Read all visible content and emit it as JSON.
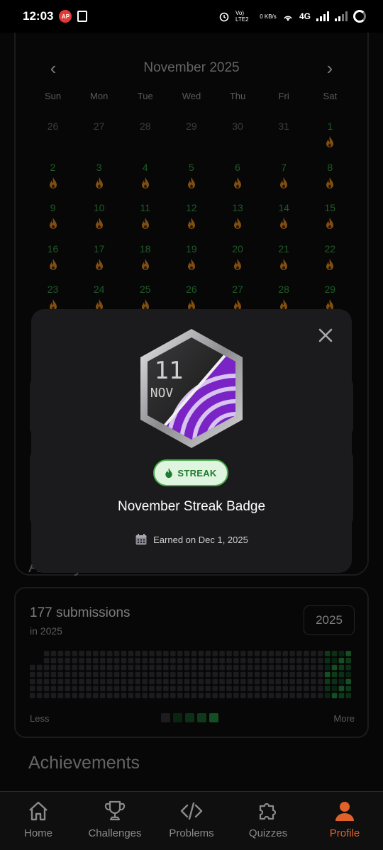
{
  "status_bar": {
    "time": "12:03",
    "ap": "AP",
    "net_speed": "0 KB/s",
    "network": "4G",
    "volte": "Vo) LTE2"
  },
  "calendar": {
    "month": "November 2025",
    "prev_icon": "chevron-left-icon",
    "next_icon": "chevron-right-icon",
    "weekdays": [
      "Sun",
      "Mon",
      "Tue",
      "Wed",
      "Thu",
      "Fri",
      "Sat"
    ],
    "days": [
      {
        "n": "26",
        "active": false
      },
      {
        "n": "27",
        "active": false
      },
      {
        "n": "28",
        "active": false
      },
      {
        "n": "29",
        "active": false
      },
      {
        "n": "30",
        "active": false
      },
      {
        "n": "31",
        "active": false
      },
      {
        "n": "1",
        "active": true
      },
      {
        "n": "2",
        "active": true
      },
      {
        "n": "3",
        "active": true
      },
      {
        "n": "4",
        "active": true
      },
      {
        "n": "5",
        "active": true
      },
      {
        "n": "6",
        "active": true
      },
      {
        "n": "7",
        "active": true
      },
      {
        "n": "8",
        "active": true
      },
      {
        "n": "9",
        "active": true
      },
      {
        "n": "10",
        "active": true
      },
      {
        "n": "11",
        "active": true
      },
      {
        "n": "12",
        "active": true
      },
      {
        "n": "13",
        "active": true
      },
      {
        "n": "14",
        "active": true
      },
      {
        "n": "15",
        "active": true
      },
      {
        "n": "16",
        "active": true
      },
      {
        "n": "17",
        "active": true
      },
      {
        "n": "18",
        "active": true
      },
      {
        "n": "19",
        "active": true
      },
      {
        "n": "20",
        "active": true
      },
      {
        "n": "21",
        "active": true
      },
      {
        "n": "22",
        "active": true
      },
      {
        "n": "23",
        "active": true
      },
      {
        "n": "24",
        "active": true
      },
      {
        "n": "25",
        "active": true
      },
      {
        "n": "26",
        "active": true
      },
      {
        "n": "27",
        "active": true
      },
      {
        "n": "28",
        "active": true
      },
      {
        "n": "29",
        "active": true
      }
    ],
    "active_color": "#2e8b3c",
    "flame_color": "#c7791a"
  },
  "activity": {
    "title": "Activity",
    "count": "177 submissions",
    "subtitle": "in 2025",
    "year": "2025",
    "less": "Less",
    "more": "More",
    "legend_colors": [
      "#2b2b31",
      "#0f3a1c",
      "#124a22",
      "#165a29",
      "#1e7a36"
    ]
  },
  "achievements_title": "Achievements",
  "modal": {
    "badge_day": "11",
    "badge_month": "NOV",
    "tag": "STREAK",
    "title": "November Streak Badge",
    "earned": "Earned on Dec 1, 2025",
    "close_icon": "close-icon"
  },
  "nav": [
    {
      "label": "Home",
      "icon": "home-icon",
      "active": false
    },
    {
      "label": "Challenges",
      "icon": "trophy-icon",
      "active": false
    },
    {
      "label": "Problems",
      "icon": "code-icon",
      "active": false
    },
    {
      "label": "Quizzes",
      "icon": "puzzle-icon",
      "active": false
    },
    {
      "label": "Profile",
      "icon": "person-icon",
      "active": true
    }
  ],
  "accent_color": "#e0622a"
}
